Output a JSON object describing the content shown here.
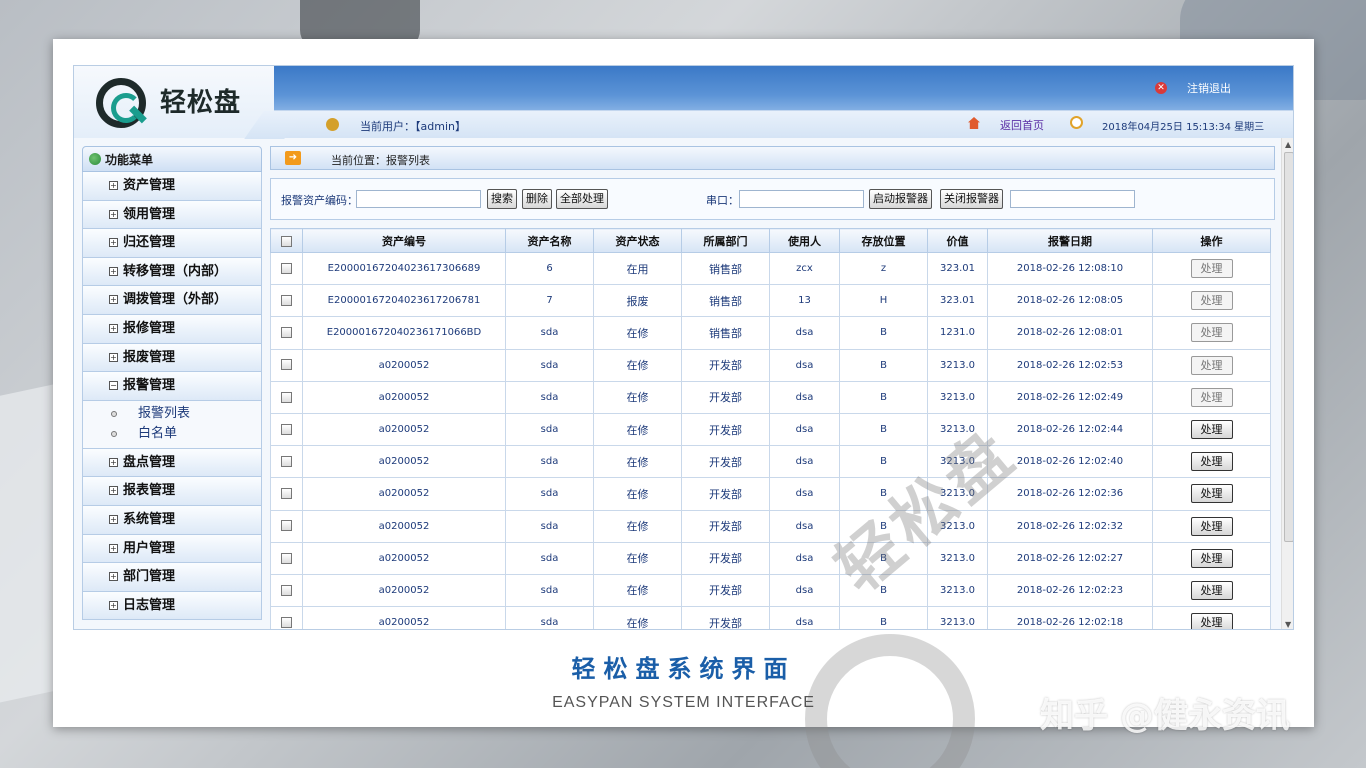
{
  "app": {
    "logo_text": "轻松盘",
    "logout": "注销退出",
    "current_user": "当前用户：【admin】",
    "home": "返回首页",
    "datetime": "2018年04月25日 15:13:34 星期三"
  },
  "sidebar": {
    "title": "功能菜单",
    "items_top": [
      "资产管理",
      "领用管理",
      "归还管理",
      "转移管理（内部）",
      "调拨管理（外部）",
      "报修管理",
      "报废管理"
    ],
    "expanded": "报警管理",
    "sub": [
      "报警列表",
      "白名单"
    ],
    "items_bottom": [
      "盘点管理",
      "报表管理",
      "系统管理",
      "用户管理",
      "部门管理",
      "日志管理"
    ]
  },
  "main": {
    "breadcrumb": "当前位置：报警列表",
    "search_label": "报警资产编码：",
    "search_btn": "搜索",
    "delete_btn": "删除",
    "process_all_btn": "全部处理",
    "serial_label": "串口：",
    "start_alarm_btn": "启动报警器",
    "stop_alarm_btn": "关闭报警器"
  },
  "table": {
    "columns": [
      "资产编号",
      "资产名称",
      "资产状态",
      "所属部门",
      "使用人",
      "存放位置",
      "价值",
      "报警日期",
      "操作"
    ],
    "rows": [
      [
        "E20000167204023617306689",
        "6",
        "在用",
        "销售部",
        "zcx",
        "z",
        "323.01",
        "2018-02-26 12:08:10",
        "处理",
        false
      ],
      [
        "E20000167204023617206781",
        "7",
        "报废",
        "销售部",
        "13",
        "H",
        "323.01",
        "2018-02-26 12:08:05",
        "处理",
        false
      ],
      [
        "E200001672040236171066BD",
        "sda",
        "在修",
        "销售部",
        "dsa",
        "B",
        "1231.0",
        "2018-02-26 12:08:01",
        "处理",
        false
      ],
      [
        "a0200052",
        "sda",
        "在修",
        "开发部",
        "dsa",
        "B",
        "3213.0",
        "2018-02-26 12:02:53",
        "处理",
        false
      ],
      [
        "a0200052",
        "sda",
        "在修",
        "开发部",
        "dsa",
        "B",
        "3213.0",
        "2018-02-26 12:02:49",
        "处理",
        false
      ],
      [
        "a0200052",
        "sda",
        "在修",
        "开发部",
        "dsa",
        "B",
        "3213.0",
        "2018-02-26 12:02:44",
        "处理",
        true
      ],
      [
        "a0200052",
        "sda",
        "在修",
        "开发部",
        "dsa",
        "B",
        "3213.0",
        "2018-02-26 12:02:40",
        "处理",
        true
      ],
      [
        "a0200052",
        "sda",
        "在修",
        "开发部",
        "dsa",
        "B",
        "3213.0",
        "2018-02-26 12:02:36",
        "处理",
        true
      ],
      [
        "a0200052",
        "sda",
        "在修",
        "开发部",
        "dsa",
        "B",
        "3213.0",
        "2018-02-26 12:02:32",
        "处理",
        true
      ],
      [
        "a0200052",
        "sda",
        "在修",
        "开发部",
        "dsa",
        "B",
        "3213.0",
        "2018-02-26 12:02:27",
        "处理",
        true
      ],
      [
        "a0200052",
        "sda",
        "在修",
        "开发部",
        "dsa",
        "B",
        "3213.0",
        "2018-02-26 12:02:23",
        "处理",
        true
      ],
      [
        "a0200052",
        "sda",
        "在修",
        "开发部",
        "dsa",
        "B",
        "3213.0",
        "2018-02-26 12:02:18",
        "处理",
        true
      ]
    ]
  },
  "caption": {
    "title": "轻松盘系统界面",
    "subtitle": "EASYPAN SYSTEM INTERFACE"
  },
  "watermark": {
    "corner": "知乎 @健永资讯",
    "diagonal": "轻松盘"
  },
  "colors": {
    "header_blue": "#3b79c7",
    "caption_blue": "#1a5ea8",
    "link_purple": "#5a2ea5"
  }
}
